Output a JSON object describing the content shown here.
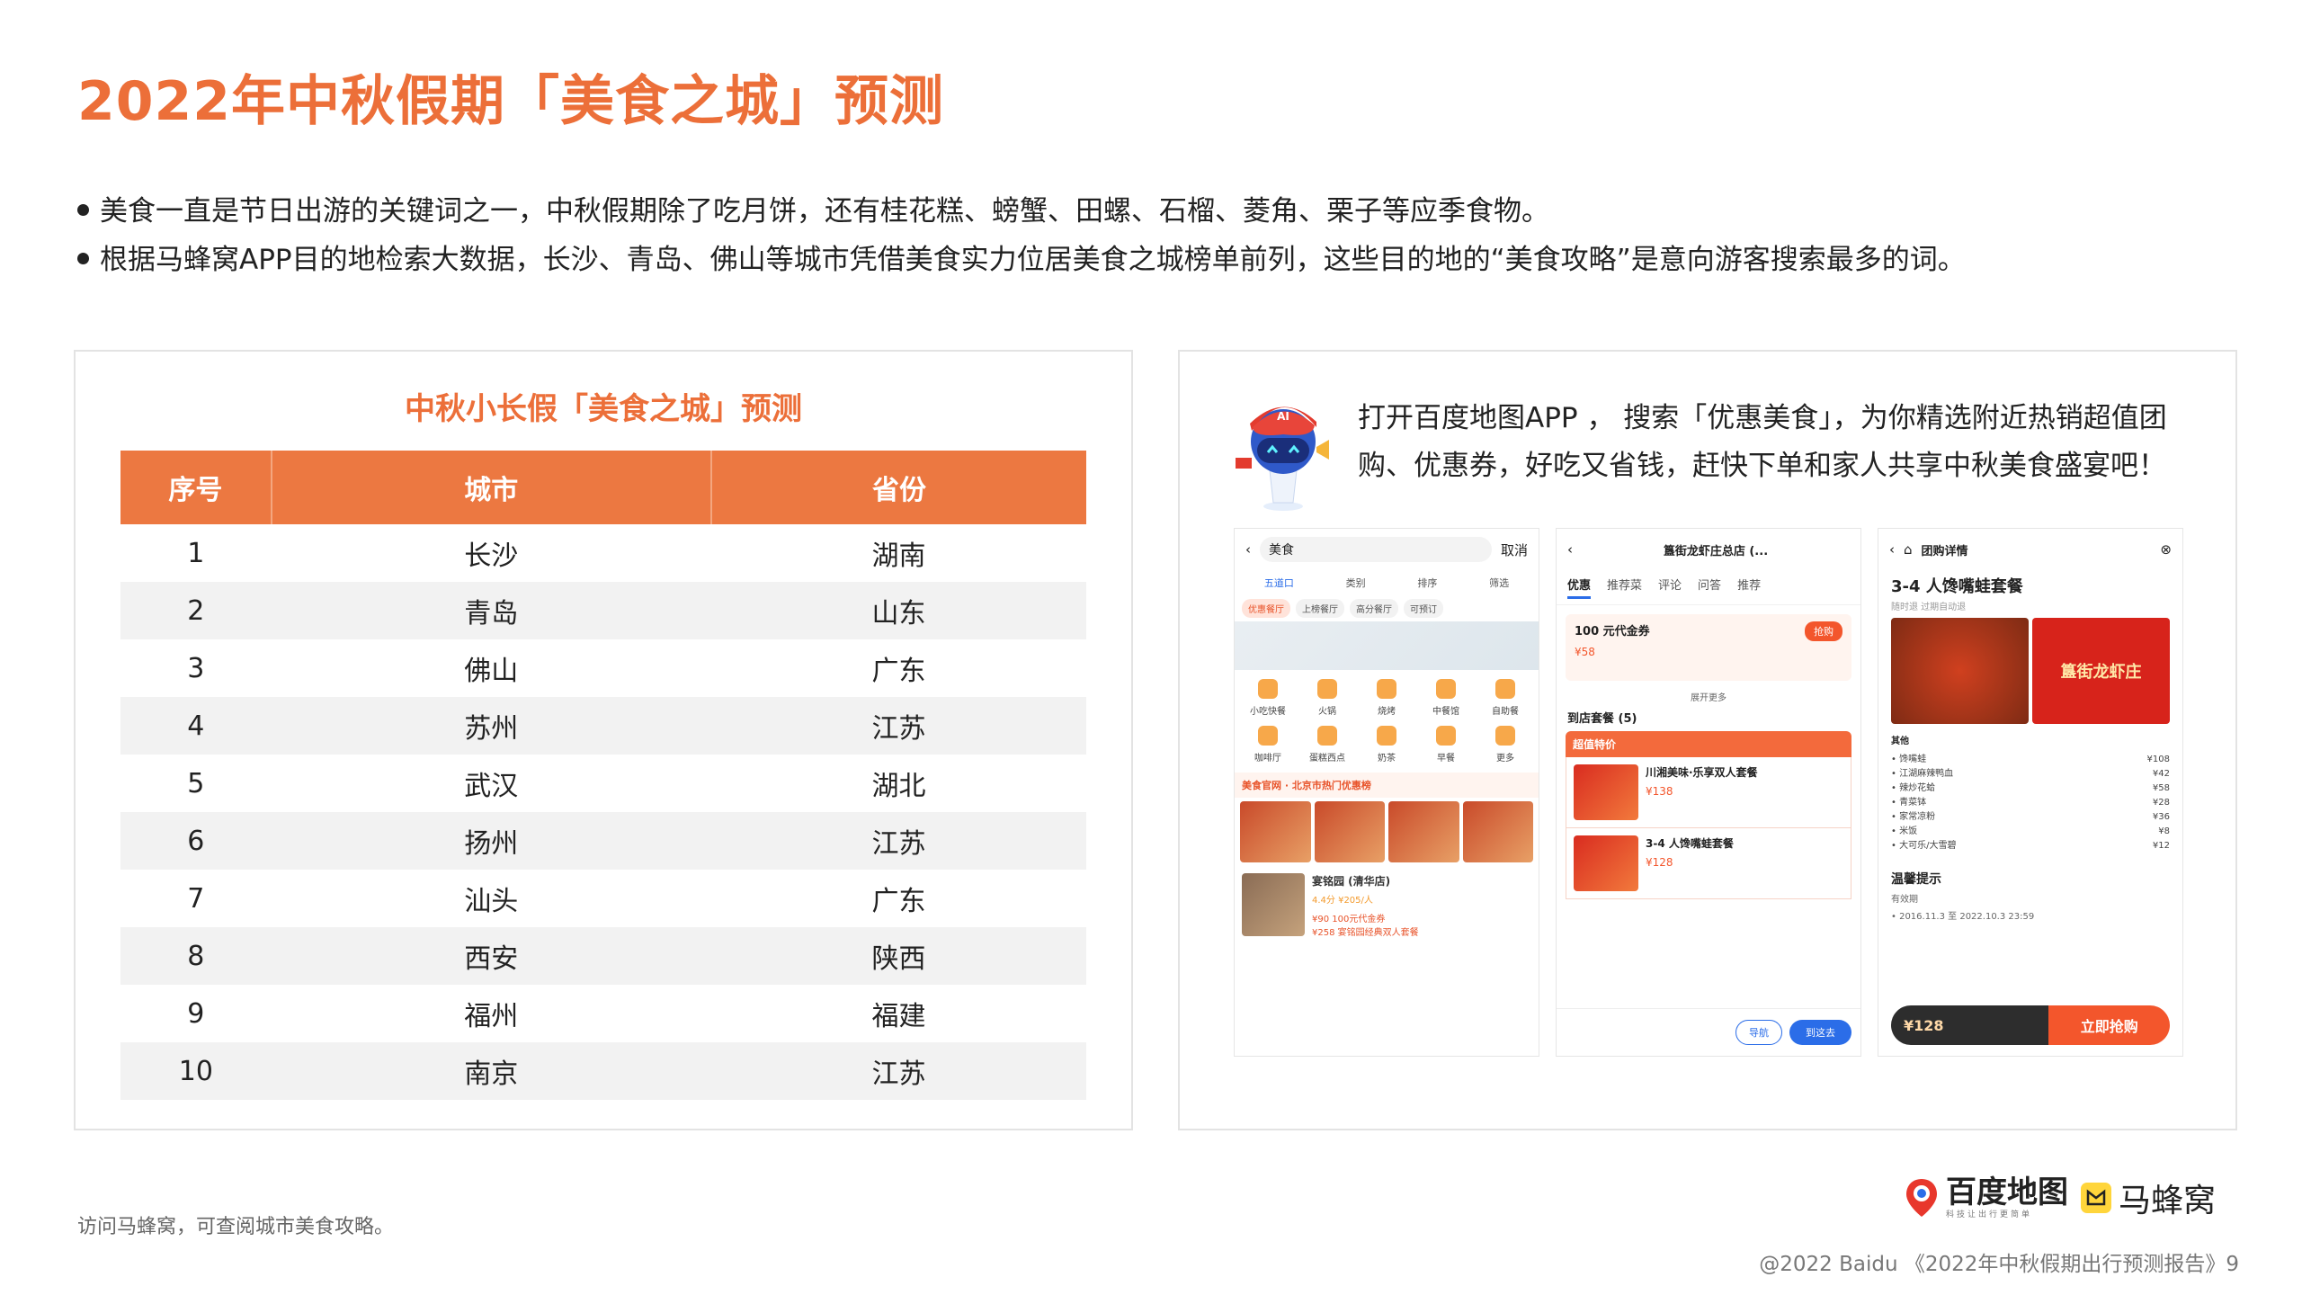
{
  "title": "2022年中秋假期「美食之城」预测",
  "bullets": [
    "美食一直是节日出游的关键词之一，中秋假期除了吃月饼，还有桂花糕、螃蟹、田螺、石榴、菱角、栗子等应季食物。",
    "根据马蜂窝APP目的地检索大数据，长沙、青岛、佛山等城市凭借美食实力位居美食之城榜单前列，这些目的地的“美食攻略”是意向游客搜索最多的词。"
  ],
  "table": {
    "title": "中秋小长假「美食之城」预测",
    "headers": [
      "序号",
      "城市",
      "省份"
    ],
    "rows": [
      [
        "1",
        "长沙",
        "湖南"
      ],
      [
        "2",
        "青岛",
        "山东"
      ],
      [
        "3",
        "佛山",
        "广东"
      ],
      [
        "4",
        "苏州",
        "江苏"
      ],
      [
        "5",
        "武汉",
        "湖北"
      ],
      [
        "6",
        "扬州",
        "江苏"
      ],
      [
        "7",
        "汕头",
        "广东"
      ],
      [
        "8",
        "西安",
        "陕西"
      ],
      [
        "9",
        "福州",
        "福建"
      ],
      [
        "10",
        "南京",
        "江苏"
      ]
    ]
  },
  "promo": {
    "text": "打开百度地图APP ， 搜索「优惠美食」，为你精选附近热销超值团购、优惠券，好吃又省钱，赶快下单和家人共享中秋美食盛宴吧！",
    "robot_label": "AI"
  },
  "phone1": {
    "search": "美食",
    "cancel": "取消",
    "filters": [
      "五道口",
      "类别",
      "排序",
      "筛选"
    ],
    "chips": [
      "优惠餐厅",
      "上榜餐厅",
      "高分餐厅",
      "可预订"
    ],
    "categories": [
      "小吃快餐",
      "火锅",
      "烧烤",
      "中餐馆",
      "自助餐",
      "咖啡厅",
      "蛋糕西点",
      "奶茶",
      "早餐",
      "更多"
    ],
    "section": "美食官网 · 北京市热门优惠榜",
    "shop_name": "宴铭园 (清华店)",
    "shop_rating": "4.4分  ¥205/人",
    "coupon1": "¥90  100元代金券",
    "coupon2": "¥258  宴铭园经典双人套餐"
  },
  "phone2": {
    "title": "簋街龙虾庄总店 (...",
    "tabs": [
      "优惠",
      "推荐菜",
      "评论",
      "问答",
      "推荐"
    ],
    "coupon_title": "100 元代金券",
    "coupon_price": "¥58",
    "grab": "抢购",
    "expand": "展开更多",
    "section": "到店套餐 (5)",
    "deal_head": "超值特价",
    "deals": [
      {
        "name": "川湘美味·乐享双人套餐",
        "price": "¥138"
      },
      {
        "name": "3-4 人馋嘴蛙套餐",
        "price": "¥128"
      }
    ],
    "nav": "导航",
    "go": "到这去"
  },
  "phone3": {
    "header": "团购详情",
    "title": "3-4 人馋嘴蛙套餐",
    "sub": "随时退  过期自动退",
    "sign": "簋街龙虾庄",
    "items_label": "其他",
    "items": [
      [
        "• 馋嘴蛙",
        "¥108"
      ],
      [
        "• 江湖麻辣鸭血",
        "¥42"
      ],
      [
        "• 辣炒花蛤",
        "¥58"
      ],
      [
        "• 青菜钵",
        "¥28"
      ],
      [
        "• 家常凉粉",
        "¥36"
      ],
      [
        "• 米饭",
        "¥8"
      ],
      [
        "• 大可乐/大雪碧",
        "¥12"
      ]
    ],
    "tip": "温馨提示",
    "validity_label": "有效期",
    "validity": "• 2016.11.3 至 2022.10.3 23:59",
    "price": "¥128",
    "buy": "立即抢购"
  },
  "source": "访问马蜂窝，可查阅城市美食攻略。",
  "logos": {
    "baidu": "百度地图",
    "baidu_sub": "科技让出行更简单",
    "mfw": "马蜂窝"
  },
  "footer": "@2022 Baidu 《2022年中秋假期出行预测报告》9",
  "colors": {
    "accent": "#ec6f39",
    "table_header": "#ec7841",
    "row_alt": "#f2f2f2"
  }
}
